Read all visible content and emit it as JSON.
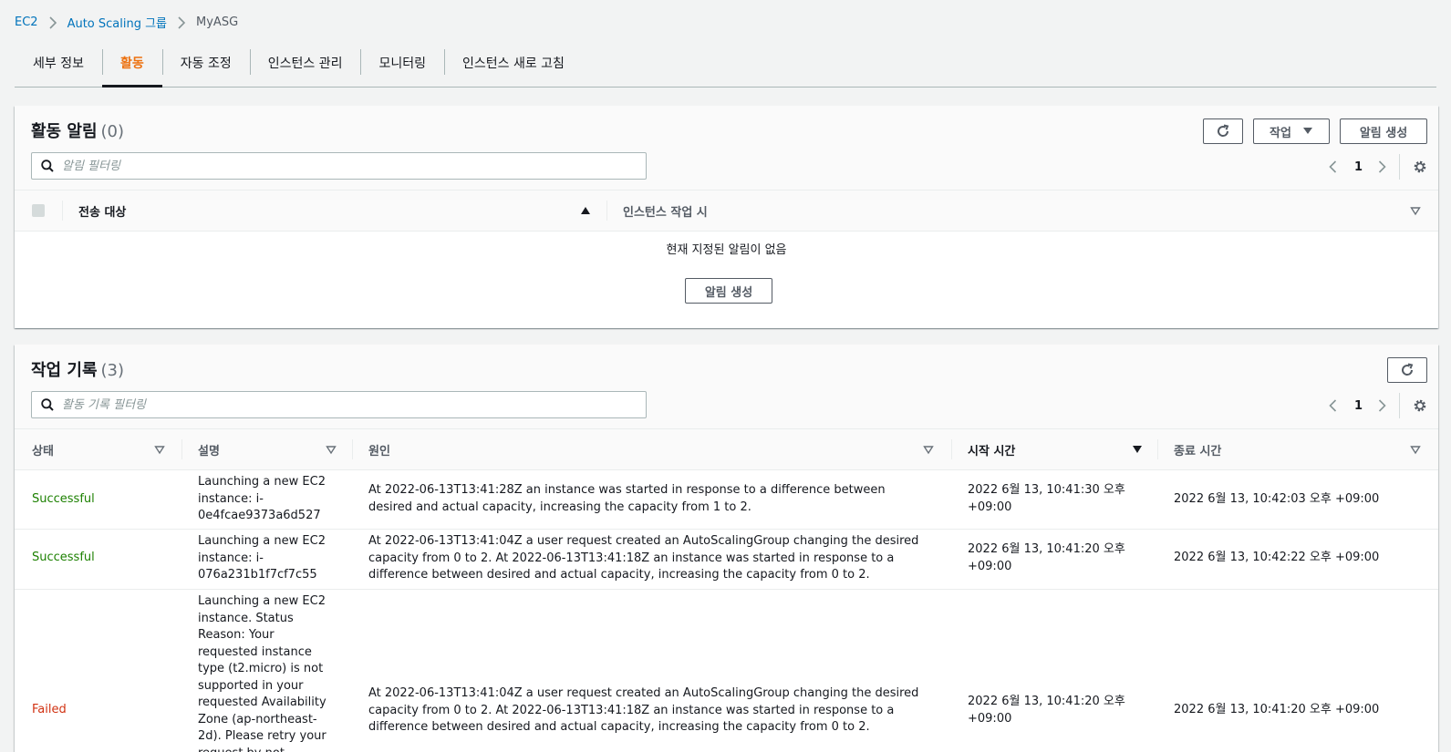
{
  "breadcrumb": {
    "ec2": "EC2",
    "asg": "Auto Scaling 그룹",
    "current": "MyASG"
  },
  "tabs": [
    "세부 정보",
    "활동",
    "자동 조정",
    "인스턴스 관리",
    "모니터링",
    "인스턴스 새로 고침"
  ],
  "active_tab": "활동",
  "notifications": {
    "title": "활동 알림",
    "count": "(0)",
    "actions_label": "작업",
    "create_label": "알림 생성",
    "search_placeholder": "알림 필터링",
    "page": "1",
    "columns": [
      "전송 대상",
      "인스턴스 작업 시"
    ],
    "empty_text": "현재 지정된 알림이 없음",
    "empty_button": "알림 생성"
  },
  "history": {
    "title": "작업 기록",
    "count": "(3)",
    "search_placeholder": "활동 기록 필터링",
    "page": "1",
    "columns": [
      "상태",
      "설명",
      "원인",
      "시작 시간",
      "종료 시간"
    ],
    "rows": [
      {
        "status": "Successful",
        "description": "Launching a new EC2 instance: i-0e4fcae9373a6d527",
        "cause": "At 2022-06-13T13:41:28Z an instance was started in response to a difference between desired and actual capacity, increasing the capacity from 1 to 2.",
        "start": "2022 6월 13, 10:41:30 오후 +09:00",
        "end": "2022 6월 13, 10:42:03 오후 +09:00"
      },
      {
        "status": "Successful",
        "description": "Launching a new EC2 instance: i-076a231b1f7cf7c55",
        "cause": "At 2022-06-13T13:41:04Z a user request created an AutoScalingGroup changing the desired capacity from 0 to 2. At 2022-06-13T13:41:18Z an instance was started in response to a difference between desired and actual capacity, increasing the capacity from 0 to 2.",
        "start": "2022 6월 13, 10:41:20 오후 +09:00",
        "end": "2022 6월 13, 10:42:22 오후 +09:00"
      },
      {
        "status": "Failed",
        "description": "Launching a new EC2 instance. Status Reason: Your requested instance type (t2.micro) is not supported in your requested Availability Zone (ap-northeast-2d). Please retry your request by not specifying an",
        "cause": "At 2022-06-13T13:41:04Z a user request created an AutoScalingGroup changing the desired capacity from 0 to 2. At 2022-06-13T13:41:18Z an instance was started in response to a difference between desired and actual capacity, increasing the capacity from 0 to 2.",
        "start": "2022 6월 13, 10:41:20 오후 +09:00",
        "end": "2022 6월 13, 10:41:20 오후 +09:00"
      }
    ]
  },
  "colors": {
    "link": "#0073bb",
    "active_tab": "#ec7211",
    "success": "#1d8102",
    "failed": "#d13212"
  },
  "icons": [
    "chevron-right-icon",
    "refresh-icon",
    "caret-down-icon",
    "search-icon",
    "chevron-left-icon",
    "gear-icon",
    "sort-ascending-icon",
    "sort-descending-icon",
    "sort-indicator-icon"
  ]
}
